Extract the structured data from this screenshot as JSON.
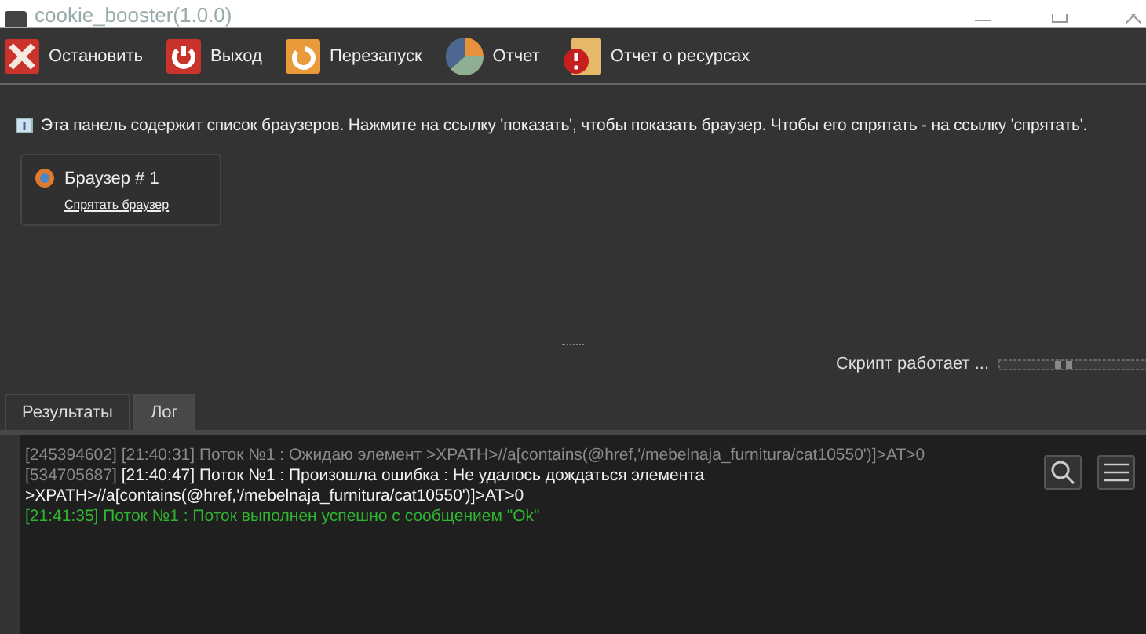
{
  "window": {
    "title": "cookie_booster(1.0.0)"
  },
  "toolbar": [
    {
      "label": "Остановить",
      "kind": "stop"
    },
    {
      "label": "Выход",
      "kind": "exit"
    },
    {
      "label": "Перезапуск",
      "kind": "restart"
    },
    {
      "label": "Отчет",
      "kind": "report"
    },
    {
      "label": "Отчет о ресурсах",
      "kind": "resources"
    }
  ],
  "info": "Эта панель содержит список браузеров. Нажмите на ссылку 'показать', чтобы показать браузер. Чтобы его спрятать - на ссылку 'спрятать'.",
  "browsers": [
    {
      "name": "Браузер # 1",
      "link": "Спрятать браузер"
    }
  ],
  "status": "Скрипт работает ...",
  "tabs": [
    {
      "label": "Результаты",
      "selected": false
    },
    {
      "label": "Лог",
      "selected": true
    }
  ],
  "log": [
    {
      "kind": "info",
      "id": "[245394602]",
      "message": "[21:40:31] Поток №1 : Ожидаю элемент >XPATH>//a[contains(@href,'/mebelnaja_furnitura/cat10550')]>AT>0"
    },
    {
      "kind": "error",
      "id": "[534705687]",
      "message": "[21:40:47] Поток №1 : Произошла ошибка : Не удалось дождаться элемента >XPATH>//a[contains(@href,'/mebelnaja_furnitura/cat10550')]>AT>0"
    },
    {
      "kind": "success",
      "message": "[21:41:35] Поток №1 : Поток выполнен успешно с сообщением \"Ok\""
    }
  ]
}
